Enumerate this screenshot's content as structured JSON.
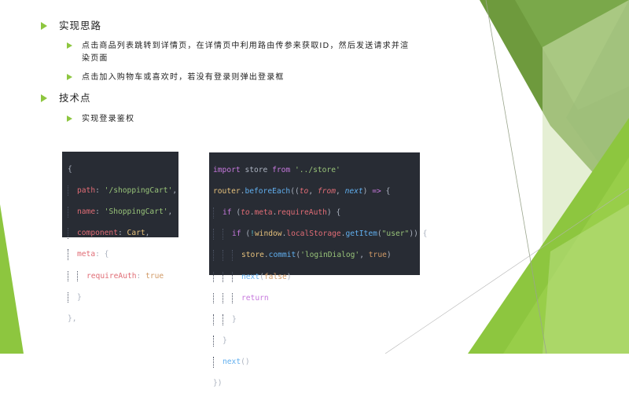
{
  "slide": {
    "bullets": [
      {
        "text": "实现思路",
        "sub": [
          "点击商品列表跳转到详情页，在详情页中利用路由传参来获取ID，然后发送请求并渲染页面",
          "点击加入购物车或喜欢时，若没有登录则弹出登录框"
        ]
      },
      {
        "text": "技术点",
        "sub": [
          "实现登录鉴权"
        ]
      }
    ],
    "sub1_line1": "点击商品列表跳转到详情页，在详情页中利用路由传参来获取ID，然后发送请求并渲",
    "sub1_line2": "染页面"
  },
  "code_left": {
    "open": "{",
    "path_key": "path",
    "path_val": "'/shoppingCart'",
    "name_key": "name",
    "name_val": "'ShoppingCart'",
    "comp_key": "component",
    "comp_val": "Cart",
    "meta_key": "meta",
    "meta_open": "{",
    "req_key": "requireAuth",
    "req_val": "true",
    "meta_close": "}",
    "close": "},"
  },
  "code_right": {
    "import": "import",
    "store": "store",
    "from": "from",
    "store_path": "'../store'",
    "router": "router",
    "beforeEach": "beforeEach",
    "to": "to",
    "fromv": "from",
    "next": "next",
    "if": "if",
    "to2": "to",
    "meta": "meta",
    "requireAuth": "requireAuth",
    "window": "window",
    "localStorage": "localStorage",
    "getItem": "getItem",
    "user": "\"user\"",
    "commit": "commit",
    "loginDialog": "'loginDialog'",
    "true": "true",
    "false": "false",
    "return": "return"
  }
}
